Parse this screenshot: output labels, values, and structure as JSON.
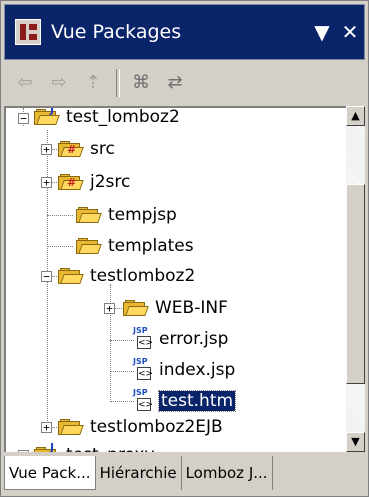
{
  "view": {
    "title": "Vue Packages",
    "menu_glyph": "▼",
    "close_glyph": "✕"
  },
  "toolbar": {
    "back_icon": "back-arrow",
    "forward_icon": "forward-arrow",
    "up_icon": "up-arrow",
    "collapse_icon": "collapse-all",
    "link_icon": "link-with-editor"
  },
  "tree": {
    "items": [
      {
        "label": "test_lomboz2",
        "type": "project"
      },
      {
        "label": "src",
        "type": "package-folder"
      },
      {
        "label": "j2src",
        "type": "package-folder"
      },
      {
        "label": "tempjsp",
        "type": "folder"
      },
      {
        "label": "templates",
        "type": "folder"
      },
      {
        "label": "testlomboz2",
        "type": "folder"
      },
      {
        "label": "WEB-INF",
        "type": "folder"
      },
      {
        "label": "error.jsp",
        "type": "jsp"
      },
      {
        "label": "index.jsp",
        "type": "jsp"
      },
      {
        "label": "test.htm",
        "type": "jsp",
        "selected": true
      },
      {
        "label": "testlomboz2EJB",
        "type": "folder"
      },
      {
        "label": "test_proxy",
        "type": "project"
      }
    ]
  },
  "tabs": [
    {
      "label": "Vue Pack...",
      "active": true
    },
    {
      "label": "Hiérarchie",
      "active": false
    },
    {
      "label": "Lomboz J...",
      "active": false
    }
  ],
  "colors": {
    "titlebar": "#0a246a",
    "selection": "#0a246a",
    "folder": "#e8b830"
  }
}
